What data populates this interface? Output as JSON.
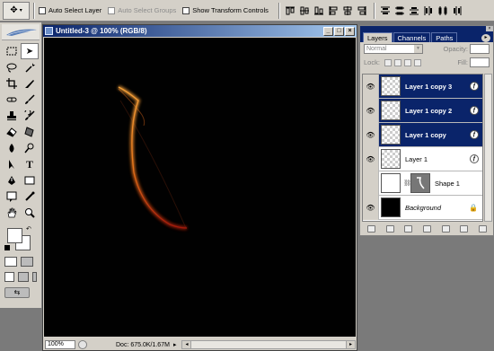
{
  "options_bar": {
    "tool_preset_icon": "move-tool-icon",
    "auto_select_layer": {
      "label": "Auto Select Layer",
      "checked": false
    },
    "auto_select_groups": {
      "label": "Auto Select Groups",
      "checked": false,
      "disabled": true
    },
    "show_transform_controls": {
      "label": "Show Transform Controls",
      "checked": false
    },
    "align_icons": [
      "align-top-icon",
      "align-vcenter-icon",
      "align-bottom-icon",
      "align-left-icon",
      "align-hcenter-icon",
      "align-right-icon"
    ],
    "distribute_icons": [
      "distribute-top-icon",
      "distribute-vcenter-icon",
      "distribute-bottom-icon",
      "distribute-left-icon",
      "distribute-hcenter-icon",
      "distribute-right-icon"
    ]
  },
  "toolbox": {
    "tools": [
      "marquee-tool-icon",
      "move-tool-icon",
      "lasso-tool-icon",
      "magic-wand-icon",
      "crop-tool-icon",
      "slice-tool-icon",
      "healing-brush-icon",
      "brush-tool-icon",
      "clone-stamp-icon",
      "history-brush-icon",
      "eraser-tool-icon",
      "gradient-tool-icon",
      "blur-tool-icon",
      "dodge-tool-icon",
      "path-selection-icon",
      "type-tool-icon",
      "pen-tool-icon",
      "shape-tool-icon",
      "notes-tool-icon",
      "eyedropper-icon",
      "hand-tool-icon",
      "zoom-tool-icon"
    ],
    "foreground_color": "#ffffff",
    "background_color": "#ffffff"
  },
  "document": {
    "title": "Untitled-3 @ 100% (RGB/8)",
    "zoom": "100%",
    "doc_info": "Doc: 675.0K/1.67M",
    "canvas_color": "#010101",
    "stroke_colors": [
      "#f3a03a",
      "#e05a1c",
      "#8a1a0a"
    ]
  },
  "layers_panel": {
    "tabs": [
      "Layers",
      "Channels",
      "Paths"
    ],
    "active_tab": "Layers",
    "blend_mode": "Normal",
    "opacity_label": "Opacity:",
    "lock_label": "Lock:",
    "fill_label": "Fill:",
    "layers": [
      {
        "name": "Layer 1 copy 3",
        "selected": true,
        "visible": true,
        "effects": true
      },
      {
        "name": "Layer 1 copy 2",
        "selected": true,
        "visible": true,
        "effects": true
      },
      {
        "name": "Layer 1 copy",
        "selected": true,
        "visible": true,
        "effects": true
      },
      {
        "name": "Layer 1",
        "selected": false,
        "visible": true,
        "effects": true
      },
      {
        "name": "Shape 1",
        "selected": false,
        "visible": false,
        "effects": false
      },
      {
        "name": "Background",
        "selected": false,
        "visible": true,
        "locked": true
      }
    ],
    "selection_color": "#0a246a"
  }
}
